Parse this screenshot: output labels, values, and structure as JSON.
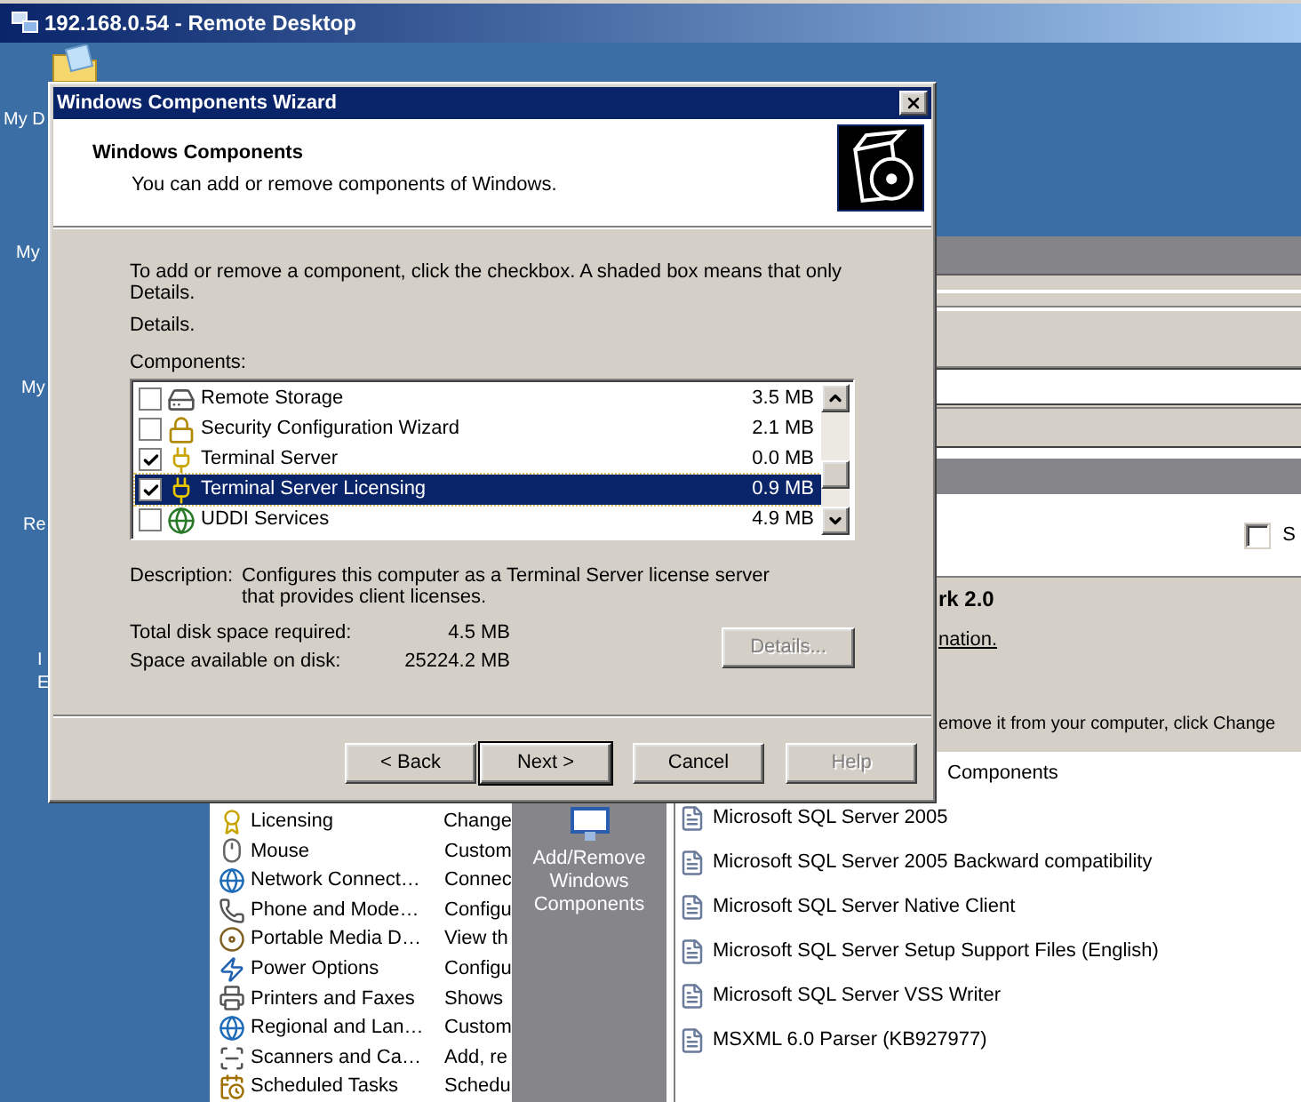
{
  "window": {
    "title": "192.168.0.54 - Remote Desktop"
  },
  "desktop_icons": [
    {
      "label": "My D"
    },
    {
      "label": "My"
    },
    {
      "label": "My"
    },
    {
      "label": "Re"
    },
    {
      "label": "I"
    },
    {
      "label": "E"
    }
  ],
  "background_window": {
    "checkbox": {
      "label": "S",
      "checked": false
    },
    "info": {
      "heading": "rk 2.0",
      "link": "nation.",
      "text": "emove it from your computer, click Change"
    },
    "control_panel_items": [
      {
        "name": "Licensing",
        "description": "Change"
      },
      {
        "name": "Mouse",
        "description": "Custom"
      },
      {
        "name": "Network Connect…",
        "description": "Connec"
      },
      {
        "name": "Phone and Mode…",
        "description": "Configu"
      },
      {
        "name": "Portable Media D…",
        "description": "View th"
      },
      {
        "name": "Power Options",
        "description": "Configu"
      },
      {
        "name": "Printers and Faxes",
        "description": "Shows"
      },
      {
        "name": "Regional and Lan…",
        "description": "Custom"
      },
      {
        "name": "Scanners and Ca…",
        "description": "Add, re"
      },
      {
        "name": "Scheduled Tasks",
        "description": "Schedu"
      }
    ],
    "side_task": {
      "label": "Add/Remove Windows Components"
    },
    "programs": [
      {
        "name": "Components",
        "kind": "cut"
      },
      {
        "name": "Microsoft SQL Server 2005",
        "kind": "program"
      },
      {
        "name": "Microsoft SQL Server 2005 Backward compatibility",
        "kind": "program"
      },
      {
        "name": "Microsoft SQL Server Native Client",
        "kind": "program"
      },
      {
        "name": "Microsoft SQL Server Setup Support Files (English)",
        "kind": "program"
      },
      {
        "name": "Microsoft SQL Server VSS Writer",
        "kind": "program"
      },
      {
        "name": "MSXML 6.0 Parser (KB927977)",
        "kind": "program"
      }
    ]
  },
  "dialog": {
    "title": "Windows Components Wizard",
    "heading": "Windows Components",
    "subheading": "You can add or remove components of Windows.",
    "instructions": "To add or remove a component, click the checkbox. A shaded box means that only",
    "details_lines": [
      "Details.",
      "Details."
    ],
    "components_label": "Components:",
    "components": [
      {
        "name": "Remote Storage",
        "size": "3.5 MB",
        "checked": false,
        "selected": false
      },
      {
        "name": "Security Configuration Wizard",
        "size": "2.1 MB",
        "checked": false,
        "selected": false
      },
      {
        "name": "Terminal Server",
        "size": "0.0 MB",
        "checked": true,
        "selected": false
      },
      {
        "name": "Terminal Server Licensing",
        "size": "0.9 MB",
        "checked": true,
        "selected": true
      },
      {
        "name": "UDDI Services",
        "size": "4.9 MB",
        "checked": false,
        "selected": false
      }
    ],
    "description_label": "Description:",
    "description": "Configures this computer as a Terminal Server license server that provides client licenses.",
    "disk_rows": [
      {
        "label": "Total disk space required:",
        "value": "4.5 MB"
      },
      {
        "label": "Space available on disk:",
        "value": "25224.2 MB"
      }
    ],
    "details_button": {
      "label": "Details...",
      "disabled": true
    },
    "buttons": [
      {
        "label": "< Back",
        "disabled": false,
        "default": false
      },
      {
        "label": "Next >",
        "disabled": false,
        "default": true
      },
      {
        "label": "Cancel",
        "disabled": false,
        "default": false
      },
      {
        "label": "Help",
        "disabled": true,
        "default": false
      }
    ]
  }
}
